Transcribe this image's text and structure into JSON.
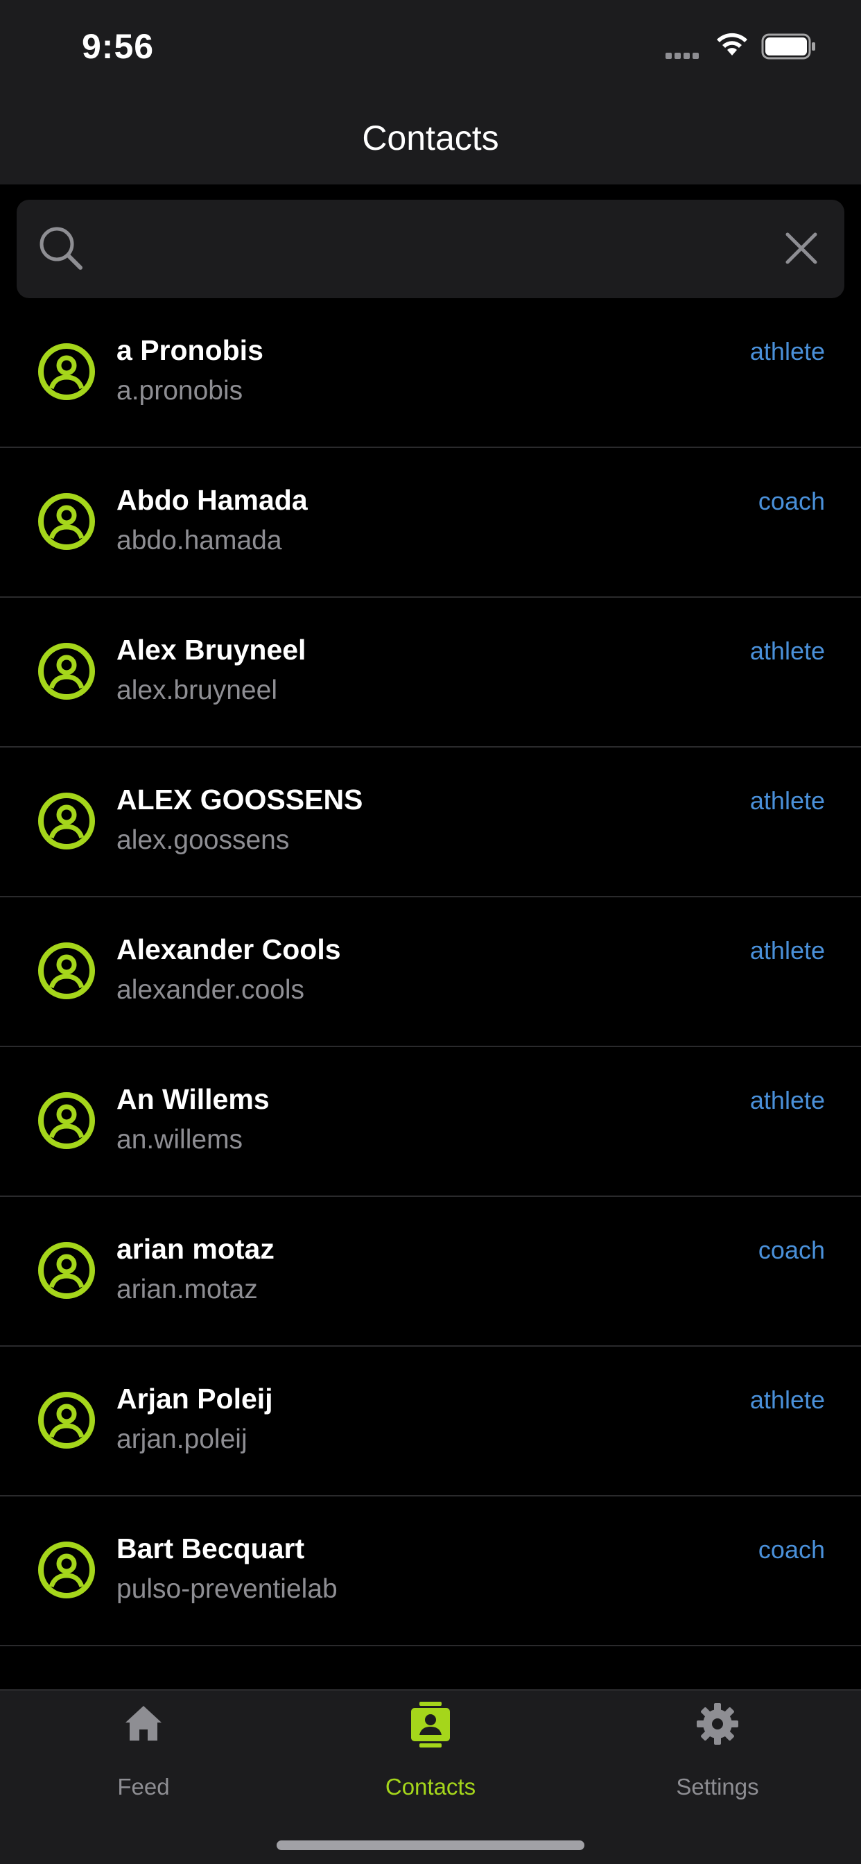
{
  "status_bar": {
    "time": "9:56"
  },
  "nav": {
    "title": "Contacts"
  },
  "search": {
    "value": "",
    "placeholder": ""
  },
  "colors": {
    "accent": "#a5d61b",
    "role_link": "#4a90d9",
    "background": "#000000",
    "bar": "#1c1c1e",
    "secondary_text": "#8e8e93"
  },
  "contacts": [
    {
      "name": "a Pronobis",
      "username": "a.pronobis",
      "role": "athlete"
    },
    {
      "name": "Abdo Hamada",
      "username": "abdo.hamada",
      "role": "coach"
    },
    {
      "name": "Alex Bruyneel",
      "username": "alex.bruyneel",
      "role": "athlete"
    },
    {
      "name": "ALEX GOOSSENS",
      "username": "alex.goossens",
      "role": "athlete"
    },
    {
      "name": "Alexander Cools",
      "username": "alexander.cools",
      "role": "athlete"
    },
    {
      "name": "An Willems",
      "username": "an.willems",
      "role": "athlete"
    },
    {
      "name": "arian motaz",
      "username": "arian.motaz",
      "role": "coach"
    },
    {
      "name": "Arjan Poleij",
      "username": "arjan.poleij",
      "role": "athlete"
    },
    {
      "name": "Bart Becquart",
      "username": "pulso-preventielab",
      "role": "coach"
    }
  ],
  "tabs": [
    {
      "label": "Feed",
      "icon": "home-icon",
      "active": false
    },
    {
      "label": "Contacts",
      "icon": "contact-card-icon",
      "active": true
    },
    {
      "label": "Settings",
      "icon": "gear-icon",
      "active": false
    }
  ]
}
